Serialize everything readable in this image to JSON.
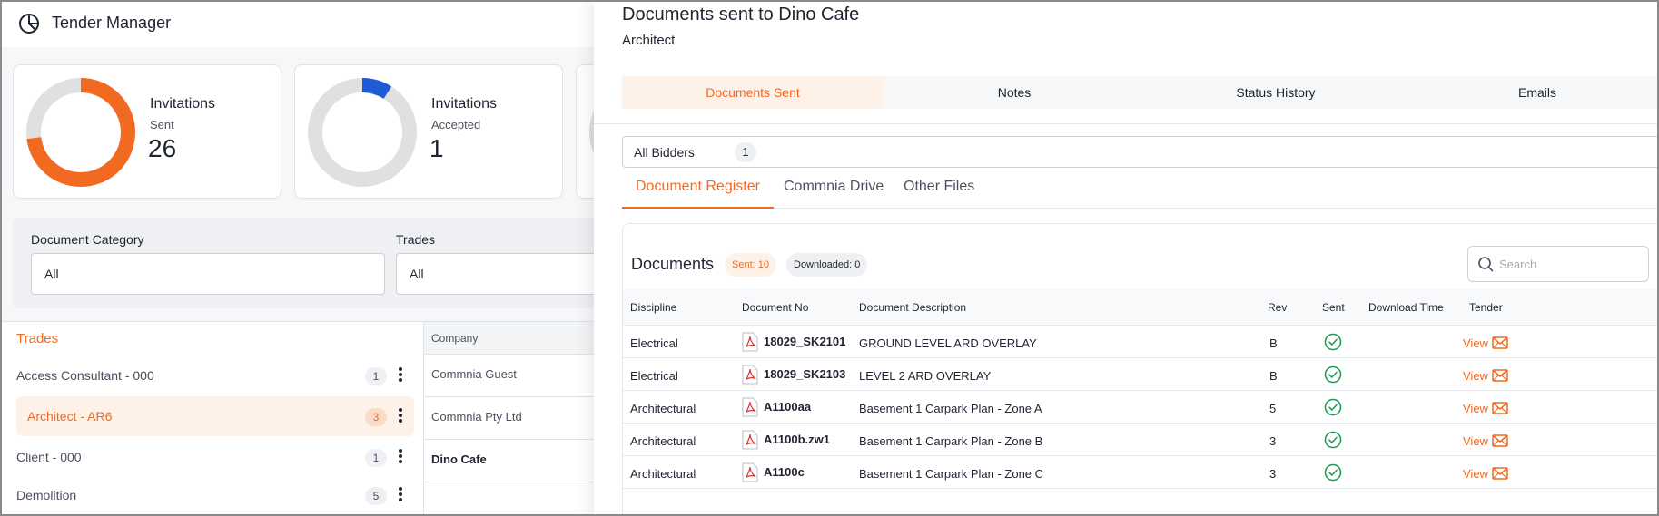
{
  "app": {
    "title": "Tender Manager"
  },
  "stats": [
    {
      "line1": "Invitations",
      "line2": "Sent",
      "value": "26",
      "fraction": 0.73,
      "color": "#f26a21"
    },
    {
      "line1": "Invitations",
      "line2": "Accepted",
      "value": "1",
      "fraction": 0.09,
      "color": "#1f5bd6"
    }
  ],
  "filters": {
    "category_label": "Document Category",
    "category_value": "All",
    "trades_label": "Trades",
    "trades_value": "All"
  },
  "trades": {
    "title": "Trades",
    "items": [
      {
        "name": "Access Consultant - 000",
        "count": "1",
        "active": false
      },
      {
        "name": "Architect - AR6",
        "count": "3",
        "active": true
      },
      {
        "name": "Client - 000",
        "count": "1",
        "active": false
      },
      {
        "name": "Demolition",
        "count": "5",
        "active": false
      }
    ]
  },
  "companies": {
    "header": "Company",
    "rows": [
      {
        "name": "Commnia Guest",
        "selected": false
      },
      {
        "name": "Commnia Pty Ltd",
        "selected": false
      },
      {
        "name": "Dino Cafe",
        "selected": true
      }
    ]
  },
  "drawer": {
    "title": "Documents sent to Dino Cafe",
    "subtitle": "Architect",
    "tabs": [
      "Documents Sent",
      "Notes",
      "Status History",
      "Emails"
    ],
    "bidders_label": "All Bidders",
    "bidders_count": "1",
    "subtabs": [
      "Document Register",
      "Commnia Drive",
      "Other Files"
    ],
    "docs_title": "Documents",
    "sent_badge": "Sent: 10",
    "downloaded_badge": "Downloaded: 0",
    "search_placeholder": "Search",
    "columns": [
      "Discipline",
      "Document No",
      "Document Description",
      "Rev",
      "Sent",
      "Download Time",
      "Tender"
    ],
    "view_label": "View",
    "rows": [
      {
        "discipline": "Electrical",
        "doc_no": "18029_SK2101",
        "description": "GROUND LEVEL ARD OVERLAY",
        "rev": "B",
        "download_time": ""
      },
      {
        "discipline": "Electrical",
        "doc_no": "18029_SK2103",
        "description": "LEVEL 2 ARD OVERLAY",
        "rev": "B",
        "download_time": ""
      },
      {
        "discipline": "Architectural",
        "doc_no": "A1100aa",
        "description": "Basement 1 Carpark Plan - Zone A",
        "rev": "5",
        "download_time": ""
      },
      {
        "discipline": "Architectural",
        "doc_no": "A1100b.zw1",
        "description": "Basement 1 Carpark Plan - Zone B",
        "rev": "3",
        "download_time": ""
      },
      {
        "discipline": "Architectural",
        "doc_no": "A1100c",
        "description": "Basement 1 Carpark Plan - Zone C",
        "rev": "3",
        "download_time": ""
      }
    ]
  },
  "colors": {
    "accent": "#f26a21",
    "accepted": "#1f5bd6",
    "check": "#1f9d55"
  }
}
